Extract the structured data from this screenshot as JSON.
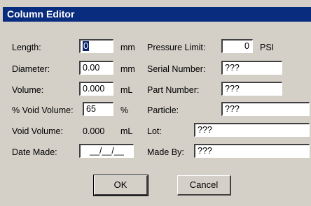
{
  "window": {
    "title": "Column Editor"
  },
  "fields": {
    "length": {
      "label": "Length:",
      "value": "0",
      "unit": "mm"
    },
    "diameter": {
      "label": "Diameter:",
      "value": "0.00",
      "unit": "mm"
    },
    "volume": {
      "label": "Volume:",
      "value": "0.000",
      "unit": "mL"
    },
    "void_pct": {
      "label": "% Void Volume:",
      "value": "65",
      "unit": "%"
    },
    "void_volume": {
      "label": "Void Volume:",
      "value": "0.000",
      "unit": "mL"
    },
    "date_made": {
      "label": "Date Made:",
      "value": "__/__/__"
    },
    "pressure_limit": {
      "label": "Pressure Limit:",
      "value": "0",
      "unit": "PSI"
    },
    "serial_number": {
      "label": "Serial Number:",
      "value": "???"
    },
    "part_number": {
      "label": "Part Number:",
      "value": "???"
    },
    "particle": {
      "label": "Particle:",
      "value": "???"
    },
    "lot": {
      "label": "Lot:",
      "value": "???"
    },
    "made_by": {
      "label": "Made By:",
      "value": "???"
    }
  },
  "buttons": {
    "ok": "OK",
    "cancel": "Cancel"
  }
}
